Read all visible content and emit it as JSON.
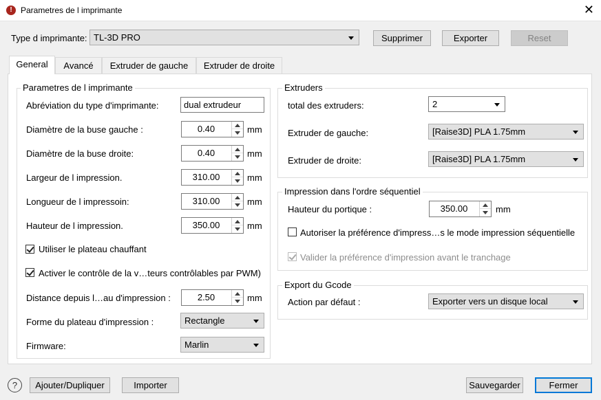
{
  "window": {
    "title": "Parametres de l imprimante",
    "icon": "raise3d-logo-icon",
    "close_glyph": "✕"
  },
  "printer_type": {
    "label": "Type d imprimante:",
    "value": "TL-3D PRO",
    "delete_button": "Supprimer",
    "export_button": "Exporter",
    "reset_button": "Reset"
  },
  "tabs": [
    {
      "label": "General",
      "active": true
    },
    {
      "label": "Avancé",
      "active": false
    },
    {
      "label": "Extruder de gauche",
      "active": false
    },
    {
      "label": "Extruder de droite",
      "active": false
    }
  ],
  "printer_params": {
    "title": "Parametres de l imprimante",
    "abbrev_label": "Abréviation du type d'imprimante:",
    "abbrev_value": "dual extrudeur",
    "nozzle_left_label": "Diamètre de la buse gauche :",
    "nozzle_left_value": "0.40",
    "nozzle_right_label": "Diamètre de la buse droite:",
    "nozzle_right_value": "0.40",
    "width_label": "Largeur de l impression.",
    "width_value": "310.00",
    "length_label": "Longueur de l impressoin:",
    "length_value": "310.00",
    "height_label": "Hauteur de l impression.",
    "height_value": "350.00",
    "unit": "mm",
    "heated_bed_label": "Utiliser le plateau chauffant",
    "heated_bed_checked": true,
    "pwm_label": "Activer le contrôle de la v…teurs contrôlables par PWM)",
    "pwm_checked": true,
    "distance_label": "Distance depuis l…au d'impression :",
    "distance_value": "2.50",
    "bed_shape_label": "Forme du plateau d'impression :",
    "bed_shape_value": "Rectangle",
    "firmware_label": "Firmware:",
    "firmware_value": "Marlin"
  },
  "extruders": {
    "title": "Extruders",
    "total_label": "total des extruders:",
    "total_value": "2",
    "left_label": "Extruder de gauche:",
    "left_value": "[Raise3D] PLA 1.75mm",
    "right_label": "Extruder de droite:",
    "right_value": "[Raise3D] PLA 1.75mm"
  },
  "sequential": {
    "title": "Impression dans l'ordre séquentiel",
    "gantry_label": "Hauteur du portique :",
    "gantry_value": "350.00",
    "unit": "mm",
    "allow_label": "Autoriser la préférence d'impress…s le mode impression séquentielle",
    "allow_checked": false,
    "validate_label": "Valider la préférence d'impression avant le tranchage",
    "validate_checked": true
  },
  "gcode_export": {
    "title": "Export du Gcode",
    "action_label": "Action par défaut :",
    "action_value": "Exporter vers un disque local"
  },
  "footer": {
    "help_glyph": "?",
    "add_duplicate": "Ajouter/Dupliquer",
    "import": "Importer",
    "save": "Sauvegarder",
    "close": "Fermer"
  }
}
